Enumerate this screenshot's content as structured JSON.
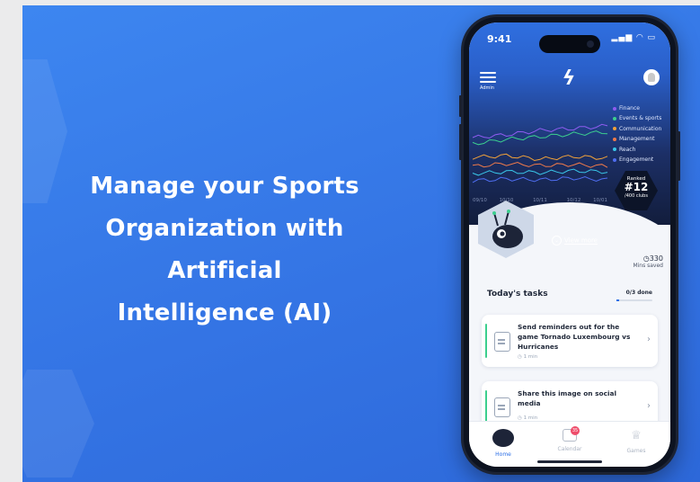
{
  "headline": {
    "lines": [
      "Manage your Sports",
      "Organization with",
      "Artificial",
      "Intelligence (AI)"
    ]
  },
  "phone": {
    "status": {
      "time": "9:41",
      "icons": "signal-wifi-battery"
    },
    "nav": {
      "menu_label": "Admin",
      "logo_icon": "bolt-logo-icon",
      "avatar_icon": "user-avatar-icon"
    },
    "chart_data": {
      "type": "line",
      "x": [
        "09/10",
        "10/10",
        "10/11",
        "10/12",
        "10/01"
      ],
      "series": [
        {
          "name": "Finance",
          "color": "#8e5cf0",
          "values": [
            62,
            65,
            70,
            72,
            75
          ]
        },
        {
          "name": "Events & sports",
          "color": "#3ccf8e",
          "values": [
            55,
            60,
            63,
            66,
            68
          ]
        },
        {
          "name": "Communication",
          "color": "#f2a23a",
          "values": [
            40,
            42,
            38,
            41,
            39
          ]
        },
        {
          "name": "Management",
          "color": "#f07a4a",
          "values": [
            30,
            33,
            31,
            32,
            30
          ]
        },
        {
          "name": "Reach",
          "color": "#39c6e8",
          "values": [
            22,
            24,
            23,
            25,
            24
          ]
        },
        {
          "name": "Engagement",
          "color": "#4f6df0",
          "values": [
            14,
            16,
            15,
            17,
            15
          ]
        }
      ],
      "ylim": [
        0,
        90
      ],
      "legend": "right",
      "grid": false
    },
    "ranking": {
      "label": "Ranked",
      "value": "#12",
      "sub": "/400 clubs"
    },
    "view_more": "View more",
    "mins": {
      "value": "330",
      "label": "Mins saved"
    },
    "tasks": {
      "title": "Today's tasks",
      "count": "0/3 done",
      "progress": 0.0,
      "items": [
        {
          "title": "Send reminders out for the game Tornado Luxembourg vs Hurricanes",
          "duration": "1 min"
        },
        {
          "title": "Share this image on social media",
          "duration": "1 min"
        }
      ]
    },
    "tabs": [
      {
        "label": "Home",
        "active": true
      },
      {
        "label": "Calendar",
        "badge": "35"
      },
      {
        "label": "Games"
      }
    ]
  },
  "colors": {
    "background": "#3474e4",
    "accent": "#2a6ee6",
    "task_bar": "#3ccf8e"
  }
}
